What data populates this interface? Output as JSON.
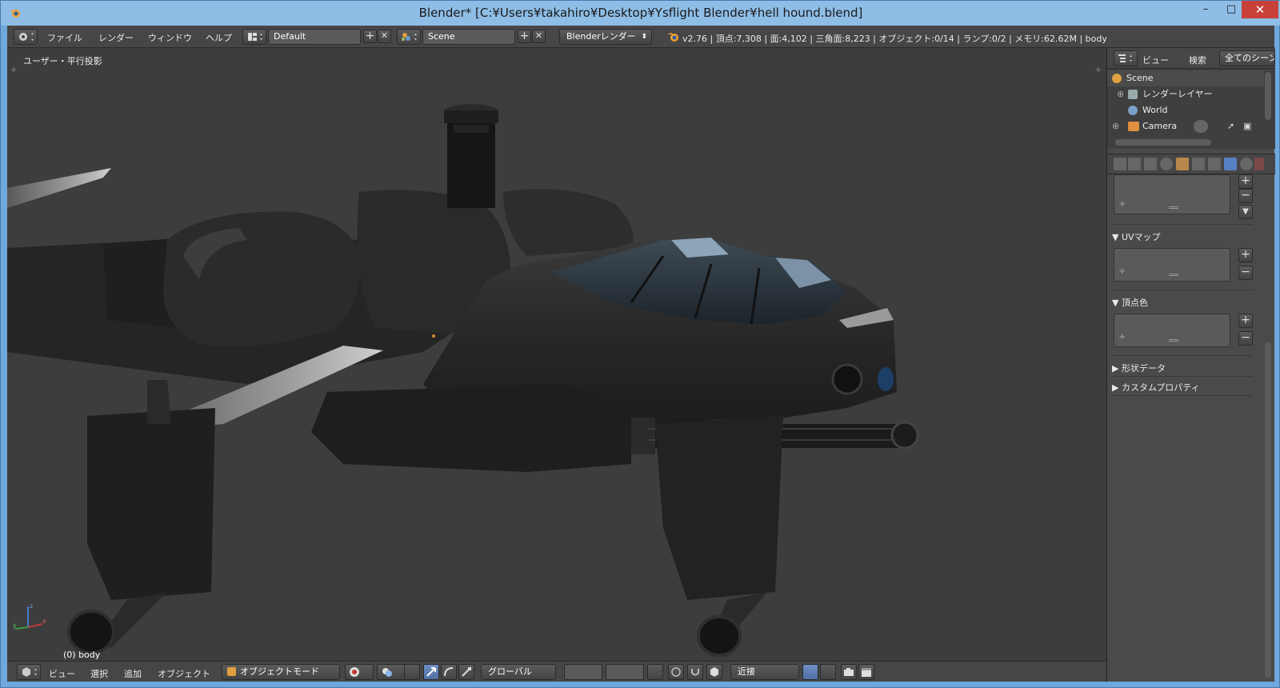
{
  "window": {
    "title": "Blender* [C:¥Users¥takahiro¥Desktop¥Ysflight Blender¥hell hound.blend]",
    "min_symbol": "–",
    "max_symbol": "□",
    "close_symbol": "✕"
  },
  "topbar": {
    "menus": [
      "ファイル",
      "レンダー",
      "ウィンドウ",
      "ヘルプ"
    ],
    "screen_layout": "Default",
    "scene": "Scene",
    "render_engine": "Blenderレンダー",
    "stats": "v2.76 | 頂点:7,308 | 面:4,102 | 三角面:8,223 | オブジェクト:0/14 | ランプ:0/2 | メモリ:62.62M | body"
  },
  "viewport": {
    "view_label": "ユーザー・平行投影",
    "object_label": "(0) body"
  },
  "bottombar": {
    "menus": [
      "ビュー",
      "選択",
      "追加",
      "オブジェクト"
    ],
    "mode": "オブジェクトモード",
    "orientation": "グローバル",
    "snap_target": "近接"
  },
  "outliner": {
    "menus": [
      "ビュー",
      "検索"
    ],
    "display_mode": "全てのシーン",
    "items": [
      {
        "label": "Scene",
        "icon": "scene-icon"
      },
      {
        "label": "レンダーレイヤー",
        "icon": "render-layers-icon"
      },
      {
        "label": "World",
        "icon": "world-icon"
      },
      {
        "label": "Camera",
        "icon": "camera-icon"
      }
    ]
  },
  "properties": {
    "panels": [
      {
        "label": "UVマップ",
        "expanded": true
      },
      {
        "label": "頂点色",
        "expanded": true
      },
      {
        "label": "形状データ",
        "expanded": false
      },
      {
        "label": "カスタムプロパティ",
        "expanded": false
      }
    ],
    "expanded_arrow": "▼",
    "collapsed_arrow": "▶"
  },
  "colors": {
    "background": "#3d3d3d",
    "header": "#464646",
    "accent": "#5680c2",
    "close": "#c7413a"
  }
}
